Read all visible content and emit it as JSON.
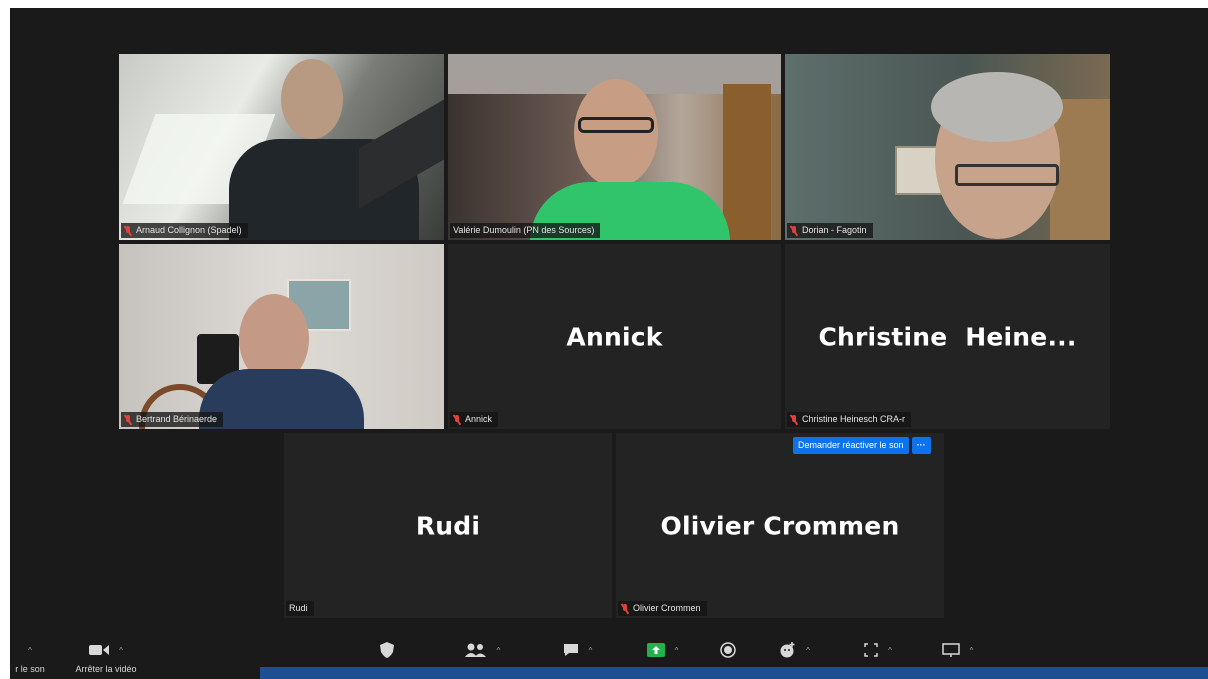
{
  "participants": {
    "tile1": {
      "name": "Arnaud Collignon (Spadel)",
      "muted": true
    },
    "tile2": {
      "name": "Valérie Dumoulin (PN des Sources)",
      "muted": false,
      "active_speaker": true
    },
    "tile3": {
      "name": "Dorian - Fagotin",
      "muted": true
    },
    "tile4": {
      "name": "Bertrand Bérinaerde",
      "muted": true
    },
    "tile5": {
      "display_name": "Annick",
      "name": "Annick",
      "muted": true
    },
    "tile6": {
      "display_name": "Christine  Heine...",
      "name": "Christine Heinesch CRA-r",
      "muted": true
    },
    "tile7": {
      "display_name": "Rudi",
      "name": "Rudi",
      "muted": false
    },
    "tile8": {
      "display_name": "Olivier Crommen",
      "name": "Olivier Crommen",
      "muted": true
    }
  },
  "unmute_request": {
    "label": "Demander réactiver le son",
    "more": "···"
  },
  "toolbar": {
    "unmute_label": "r le son",
    "stop_video_label": "Arrêter la vidéo"
  },
  "colors": {
    "active_speaker_border": "#cde049",
    "muted_icon": "#e0413a",
    "request_button": "#0e72ed",
    "share_screen": "#22b14c"
  }
}
